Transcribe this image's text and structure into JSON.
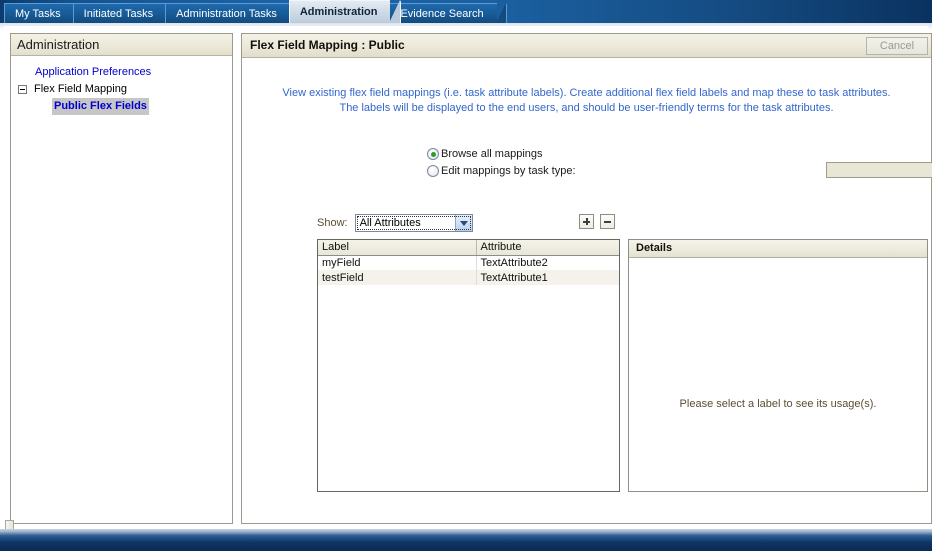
{
  "tabs": [
    {
      "label": "My Tasks",
      "active": false
    },
    {
      "label": "Initiated Tasks",
      "active": false
    },
    {
      "label": "Administration Tasks",
      "active": false
    },
    {
      "label": "Administration",
      "active": true
    },
    {
      "label": "Evidence Search",
      "active": false
    }
  ],
  "sidebar": {
    "header": "Administration",
    "items": [
      {
        "label": "Application Preferences",
        "style": "link",
        "expander": false
      },
      {
        "label": "Flex Field Mapping",
        "style": "plain",
        "expander": true
      },
      {
        "label": "Public Flex Fields",
        "style": "selected",
        "expander": false
      }
    ]
  },
  "splitter": {
    "collapse_icon": "left-arrow-icon"
  },
  "content": {
    "title": "Flex Field Mapping : Public",
    "cancel_label": "Cancel",
    "instructions_line1": "View existing flex field mappings (i.e. task attribute labels). Create additional flex field labels and map these to task attributes.",
    "instructions_line2": "The labels will be displayed to the end users, and should be user-friendly terms for the task attributes.",
    "radios": [
      {
        "label": "Browse all mappings",
        "checked": true
      },
      {
        "label": "Edit mappings by task type:",
        "checked": false
      }
    ],
    "task_type_value": "",
    "task_type_placeholder": "",
    "lov_icon": "flashlight-icon",
    "show_label": "Show:",
    "show_selected": "All Attributes",
    "show_options": [
      "All Attributes"
    ],
    "add_button_label": "+",
    "remove_button_label": "−",
    "table": {
      "columns": [
        "Label",
        "Attribute"
      ],
      "rows": [
        [
          "myField",
          "TextAttribute2"
        ],
        [
          "testField",
          "TextAttribute1"
        ]
      ]
    },
    "details": {
      "header": "Details",
      "empty_message": "Please select a label to see its usage(s)."
    }
  },
  "colors": {
    "tab_active_bg": "#cdd9e6",
    "tab_bar_blue": "#1c63a6",
    "link_blue": "#0000cc",
    "instruction_blue": "#3366cc",
    "label_brown": "#5c4d33",
    "radio_green": "#2a9d2a",
    "panel_beige": "#ece9da"
  }
}
